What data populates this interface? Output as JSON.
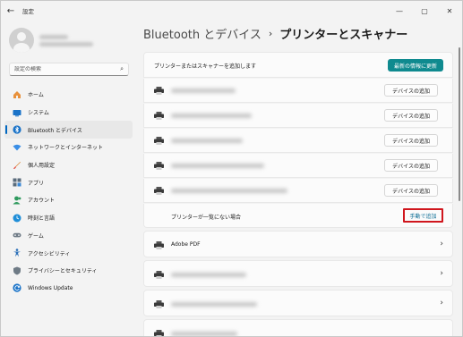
{
  "window": {
    "title": "設定",
    "back_icon": "back-arrow-icon",
    "controls": {
      "minimize": "—",
      "maximize": "▢",
      "close": "✕"
    }
  },
  "sidebar": {
    "search_placeholder": "設定の検索",
    "items": [
      {
        "label": "ホーム",
        "icon": "home-icon",
        "active": false
      },
      {
        "label": "システム",
        "icon": "system-icon",
        "active": false
      },
      {
        "label": "Bluetooth とデバイス",
        "icon": "bluetooth-icon",
        "active": true
      },
      {
        "label": "ネットワークとインターネット",
        "icon": "network-icon",
        "active": false
      },
      {
        "label": "個人用設定",
        "icon": "brush-icon",
        "active": false
      },
      {
        "label": "アプリ",
        "icon": "apps-icon",
        "active": false
      },
      {
        "label": "アカウント",
        "icon": "account-icon",
        "active": false
      },
      {
        "label": "時刻と言語",
        "icon": "globe-clock-icon",
        "active": false
      },
      {
        "label": "ゲーム",
        "icon": "gamepad-icon",
        "active": false
      },
      {
        "label": "アクセシビリティ",
        "icon": "accessibility-icon",
        "active": false
      },
      {
        "label": "プライバシーとセキュリティ",
        "icon": "shield-icon",
        "active": false
      },
      {
        "label": "Windows Update",
        "icon": "update-icon",
        "active": false
      }
    ]
  },
  "main": {
    "breadcrumb": {
      "parent": "Bluetooth とデバイス",
      "separator": "›",
      "current": "プリンターとスキャナー"
    },
    "add_section": {
      "header_text": "プリンターまたはスキャナーを追加します",
      "refresh_button": "最新の情報に更新",
      "add_device_button": "デバイスの追加",
      "manual_text": "プリンターが一覧にない場合",
      "manual_button": "手動で追加"
    },
    "devices": [
      {
        "name": "Adobe PDF"
      }
    ]
  },
  "colors": {
    "accent": "#0f8a8f",
    "nav_indicator": "#0067c0",
    "highlight_border": "#d0161d"
  }
}
